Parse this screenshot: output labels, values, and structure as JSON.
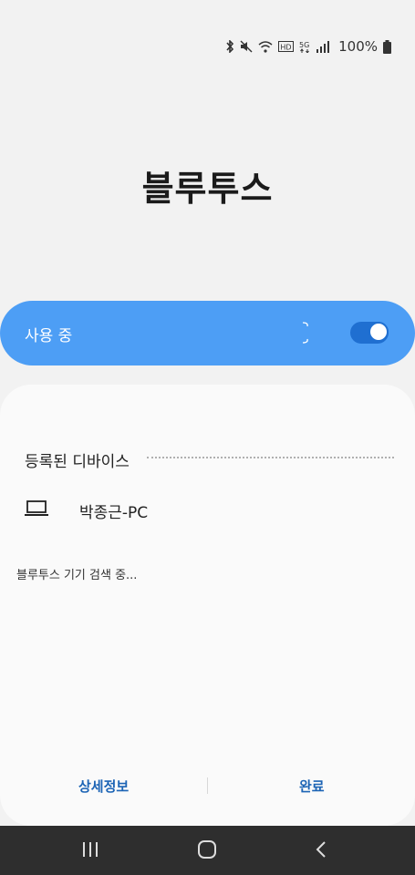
{
  "status_bar": {
    "icons": [
      "bluetooth-icon",
      "mute-icon",
      "wifi-icon",
      "hd-voice-icon",
      "5g-icon",
      "signal-icon",
      "battery-icon"
    ],
    "hd_label": "HD",
    "network_label": "5G",
    "battery": "100%"
  },
  "page": {
    "title": "블루투스"
  },
  "toggle": {
    "label": "사용 중",
    "enabled": true,
    "accent": "#4d9ef5"
  },
  "registered": {
    "header": "등록된 디바이스",
    "devices": [
      {
        "name": "박종근-PC",
        "icon": "laptop-icon"
      }
    ]
  },
  "scanning_text": "블루투스 기기 검색 중...",
  "actions": {
    "details": "상세정보",
    "done": "완료"
  },
  "navbar": {
    "buttons": [
      "recent-apps-icon",
      "home-icon",
      "back-icon"
    ]
  }
}
